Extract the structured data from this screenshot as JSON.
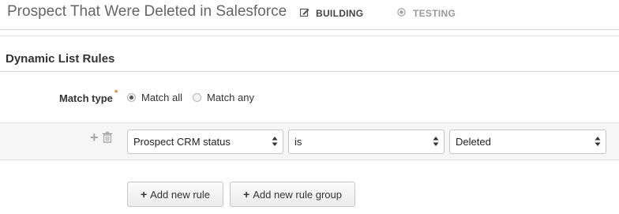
{
  "header": {
    "title": "Prospect That Were Deleted in Salesforce",
    "steps": [
      {
        "label": "BUILDING",
        "icon": "edit-icon",
        "active": true
      },
      {
        "label": "TESTING",
        "icon": "target-icon",
        "active": false
      }
    ]
  },
  "section": {
    "title": "Dynamic List Rules"
  },
  "match_type": {
    "label": "Match type",
    "required_marker": "*",
    "options": [
      {
        "label": "Match all",
        "checked": true
      },
      {
        "label": "Match any",
        "checked": false
      }
    ]
  },
  "rule": {
    "field": "Prospect CRM status",
    "operator": "is",
    "value": "Deleted"
  },
  "buttons": {
    "add_rule": "Add new rule",
    "add_rule_group": "Add new rule group"
  },
  "colors": {
    "required": "#e07a1f",
    "active_step": "#444444",
    "inactive_step": "#9a9a9a"
  }
}
